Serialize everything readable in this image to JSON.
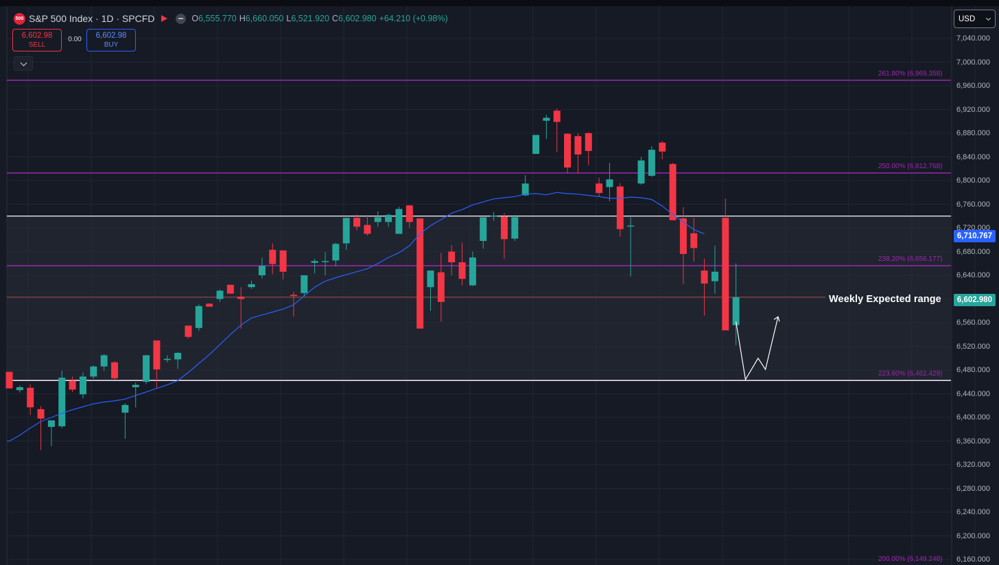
{
  "header": {
    "symbol_icon_text": "500",
    "title": "S&P 500 Index · 1D · SPCFD",
    "open_label": "O",
    "open": "6,555.770",
    "high_label": "H",
    "high": "6,660.050",
    "low_label": "L",
    "low": "6,521.920",
    "close_label": "C",
    "close": "6,602.980",
    "change": "+64.210 (+0.98%)"
  },
  "trade": {
    "sell_price": "6,602.98",
    "sell_label": "SELL",
    "spread": "0.00",
    "buy_price": "6,602.98",
    "buy_label": "BUY"
  },
  "currency": "USD",
  "colors": {
    "background": "#161a25",
    "up": "#26a69a",
    "down": "#f23645",
    "ema": "#2962ff",
    "fib": "#9c27b0",
    "range_box": "#2a2d38",
    "range_line": "#ffffff"
  },
  "chart_data": {
    "type": "candlestick",
    "y_axis_side": "right",
    "ylim": [
      6160,
      7060
    ],
    "yticks": [
      "7,040.000",
      "7,000.000",
      "6,960.000",
      "6,920.000",
      "6,880.000",
      "6,840.000",
      "6,800.000",
      "6,760.000",
      "6,720.000",
      "6,680.000",
      "6,640.000",
      "6,600.000",
      "6,560.000",
      "6,520.000",
      "6,480.000",
      "6,440.000",
      "6,400.000",
      "6,360.000",
      "6,320.000",
      "6,280.000",
      "6,240.000",
      "6,200.000",
      "6,160.000"
    ],
    "candles": [
      {
        "o": 6477,
        "h": 6477,
        "l": 6449,
        "c": 6449
      },
      {
        "o": 6446,
        "h": 6454,
        "l": 6442,
        "c": 6451
      },
      {
        "o": 6450,
        "h": 6456,
        "l": 6404,
        "c": 6417
      },
      {
        "o": 6414,
        "h": 6419,
        "l": 6345,
        "c": 6398
      },
      {
        "o": 6384,
        "h": 6393,
        "l": 6351,
        "c": 6395
      },
      {
        "o": 6385,
        "h": 6479,
        "l": 6382,
        "c": 6467
      },
      {
        "o": 6462,
        "h": 6469,
        "l": 6443,
        "c": 6447
      },
      {
        "o": 6439,
        "h": 6476,
        "l": 6432,
        "c": 6469
      },
      {
        "o": 6469,
        "h": 6488,
        "l": 6465,
        "c": 6486
      },
      {
        "o": 6486,
        "h": 6507,
        "l": 6479,
        "c": 6505
      },
      {
        "o": 6493,
        "h": 6495,
        "l": 6463,
        "c": 6466
      },
      {
        "o": 6408,
        "h": 6424,
        "l": 6364,
        "c": 6421
      },
      {
        "o": 6451,
        "h": 6459,
        "l": 6417,
        "c": 6455
      },
      {
        "o": 6460,
        "h": 6505,
        "l": 6456,
        "c": 6505
      },
      {
        "o": 6530,
        "h": 6530,
        "l": 6450,
        "c": 6481
      },
      {
        "o": 6497,
        "h": 6505,
        "l": 6493,
        "c": 6499
      },
      {
        "o": 6498,
        "h": 6510,
        "l": 6482,
        "c": 6509
      },
      {
        "o": 6555,
        "h": 6555,
        "l": 6533,
        "c": 6536
      },
      {
        "o": 6551,
        "h": 6591,
        "l": 6546,
        "c": 6588
      },
      {
        "o": 6592,
        "h": 6593,
        "l": 6587,
        "c": 6587
      },
      {
        "o": 6600,
        "h": 6616,
        "l": 6595,
        "c": 6614
      },
      {
        "o": 6624,
        "h": 6624,
        "l": 6609,
        "c": 6609
      },
      {
        "o": 6604,
        "h": 6620,
        "l": 6550,
        "c": 6600
      },
      {
        "o": 6620,
        "h": 6631,
        "l": 6617,
        "c": 6625
      },
      {
        "o": 6640,
        "h": 6670,
        "l": 6635,
        "c": 6656
      },
      {
        "o": 6683,
        "h": 6694,
        "l": 6642,
        "c": 6659
      },
      {
        "o": 6682,
        "h": 6682,
        "l": 6633,
        "c": 6646
      },
      {
        "o": 6607,
        "h": 6612,
        "l": 6570,
        "c": 6605
      },
      {
        "o": 6610,
        "h": 6637,
        "l": 6604,
        "c": 6640
      },
      {
        "o": 6661,
        "h": 6668,
        "l": 6643,
        "c": 6664
      },
      {
        "o": 6664,
        "h": 6679,
        "l": 6640,
        "c": 6664
      },
      {
        "o": 6665,
        "h": 6695,
        "l": 6655,
        "c": 6693
      },
      {
        "o": 6694,
        "h": 6724,
        "l": 6683,
        "c": 6737
      },
      {
        "o": 6737,
        "h": 6743,
        "l": 6716,
        "c": 6722
      },
      {
        "o": 6725,
        "h": 6742,
        "l": 6707,
        "c": 6710
      },
      {
        "o": 6730,
        "h": 6748,
        "l": 6722,
        "c": 6738
      },
      {
        "o": 6730,
        "h": 6744,
        "l": 6722,
        "c": 6742
      },
      {
        "o": 6710,
        "h": 6756,
        "l": 6728,
        "c": 6752
      },
      {
        "o": 6758,
        "h": 6759,
        "l": 6720,
        "c": 6730
      },
      {
        "o": 6736,
        "h": 6736,
        "l": 6550,
        "c": 6550
      },
      {
        "o": 6620,
        "h": 6640,
        "l": 6580,
        "c": 6648
      },
      {
        "o": 6645,
        "h": 6678,
        "l": 6562,
        "c": 6595
      },
      {
        "o": 6680,
        "h": 6691,
        "l": 6640,
        "c": 6662
      },
      {
        "o": 6662,
        "h": 6695,
        "l": 6623,
        "c": 6634
      },
      {
        "o": 6623,
        "h": 6680,
        "l": 6622,
        "c": 6670
      },
      {
        "o": 6698,
        "h": 6734,
        "l": 6685,
        "c": 6738
      },
      {
        "o": 6740,
        "h": 6747,
        "l": 6732,
        "c": 6741
      },
      {
        "o": 6739,
        "h": 6745,
        "l": 6668,
        "c": 6701
      },
      {
        "o": 6702,
        "h": 6742,
        "l": 6698,
        "c": 6738
      },
      {
        "o": 6775,
        "h": 6809,
        "l": 6774,
        "c": 6795
      },
      {
        "o": 6845,
        "h": 6876,
        "l": 6845,
        "c": 6877
      },
      {
        "o": 6901,
        "h": 6911,
        "l": 6870,
        "c": 6906
      },
      {
        "o": 6918,
        "h": 6922,
        "l": 6848,
        "c": 6899
      },
      {
        "o": 6879,
        "h": 6880,
        "l": 6812,
        "c": 6822
      },
      {
        "o": 6875,
        "h": 6880,
        "l": 6812,
        "c": 6844
      },
      {
        "o": 6880,
        "h": 6882,
        "l": 6826,
        "c": 6850
      },
      {
        "o": 6795,
        "h": 6805,
        "l": 6773,
        "c": 6779
      },
      {
        "o": 6789,
        "h": 6830,
        "l": 6765,
        "c": 6802
      },
      {
        "o": 6790,
        "h": 6796,
        "l": 6705,
        "c": 6718
      },
      {
        "o": 6724,
        "h": 6738,
        "l": 6638,
        "c": 6724
      },
      {
        "o": 6795,
        "h": 6840,
        "l": 6793,
        "c": 6834
      },
      {
        "o": 6808,
        "h": 6858,
        "l": 6806,
        "c": 6852
      },
      {
        "o": 6864,
        "h": 6867,
        "l": 6836,
        "c": 6849
      },
      {
        "o": 6828,
        "h": 6830,
        "l": 6737,
        "c": 6733
      },
      {
        "o": 6736,
        "h": 6755,
        "l": 6625,
        "c": 6676
      },
      {
        "o": 6711,
        "h": 6737,
        "l": 6663,
        "c": 6686
      },
      {
        "o": 6648,
        "h": 6668,
        "l": 6572,
        "c": 6626
      },
      {
        "o": 6630,
        "h": 6690,
        "l": 6609,
        "c": 6646
      },
      {
        "o": 6737,
        "h": 6770,
        "l": 6560,
        "c": 6547
      },
      {
        "o": 6555.77,
        "h": 6660.05,
        "l": 6521.92,
        "c": 6602.98
      }
    ],
    "ema": [
      6360,
      6370,
      6382,
      6393,
      6400,
      6407,
      6413,
      6418,
      6423,
      6426,
      6428,
      6431,
      6437,
      6443,
      6449,
      6455,
      6462,
      6476,
      6491,
      6506,
      6523,
      6540,
      6556,
      6568,
      6573,
      6578,
      6583,
      6590,
      6605,
      6620,
      6630,
      6636,
      6641,
      6646,
      6651,
      6660,
      6670,
      6678,
      6690,
      6710,
      6724,
      6734,
      6745,
      6751,
      6759,
      6764,
      6769,
      6771,
      6773,
      6777,
      6778,
      6776,
      6780,
      6778,
      6777,
      6775,
      6773,
      6770,
      6770,
      6772,
      6771,
      6768,
      6757,
      6743,
      6730,
      6717,
      6710
    ],
    "fib_levels": [
      {
        "label": "261.80% (6,969.358)",
        "value": 6969.358
      },
      {
        "label": "250.00% (6,812.768)",
        "value": 6812.768
      },
      {
        "label": "238.20% (6,656.177)",
        "value": 6656.177
      },
      {
        "label": "223.60% (6,462.429)",
        "value": 6462.429
      },
      {
        "label": "200.00% (6,149.248)",
        "value": 6149.248
      }
    ],
    "range_top": 6740,
    "range_bottom": 6462.429,
    "last_price": 6602.98,
    "last_price_label": "6,602.980",
    "ema_last": 6710.767,
    "ema_last_label": "6,710.767",
    "annotation": "Weekly Expected range",
    "projection": [
      {
        "bar": 69,
        "value": 6562
      },
      {
        "bar": 69.9,
        "value": 6464
      },
      {
        "bar": 71.1,
        "value": 6500
      },
      {
        "bar": 71.8,
        "value": 6481
      },
      {
        "bar": 73,
        "value": 6570
      }
    ]
  }
}
